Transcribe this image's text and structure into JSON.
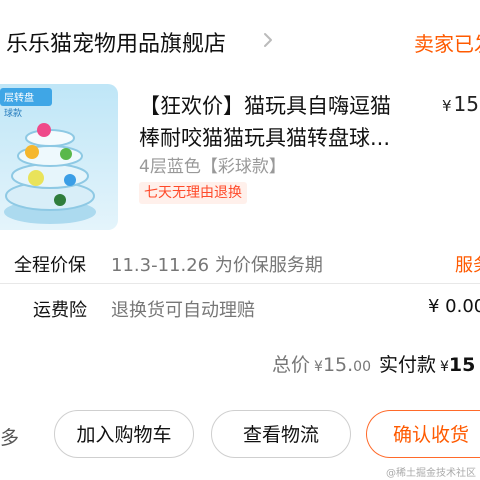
{
  "shop": {
    "name": "乐乐猫宠物用品旗舰店",
    "status": "卖家已发"
  },
  "item": {
    "image_label": "层转盘",
    "image_sublabel": "球款",
    "title_line1": "【狂欢价】猫玩具自嗨逗猫",
    "title_line2": "棒耐咬猫猫玩具猫转盘球...",
    "price_symbol": "¥",
    "price": "15",
    "sku": "4层蓝色【彩球款】",
    "return_badge": "七天无理由退换"
  },
  "services": [
    {
      "label": "全程价保",
      "value": "11.3-11.26 为价保服务期",
      "right": "服务"
    },
    {
      "label": "运费险",
      "value": "退换货可自动理赔",
      "right": "¥ 0.00"
    }
  ],
  "totals": {
    "total_label": "总价",
    "total_symbol": "¥",
    "total_amount": "15.",
    "total_decimal": "00",
    "paid_label": "实付款",
    "paid_symbol": "¥",
    "paid_amount": "15"
  },
  "footer": {
    "more_label": "多",
    "add_cart": "加入购物车",
    "logistics": "查看物流",
    "confirm": "确认收货"
  },
  "watermark": "@稀土掘金技术社区",
  "colors": {
    "accent": "#ff5a00",
    "badge_bg": "#fff0eb"
  }
}
